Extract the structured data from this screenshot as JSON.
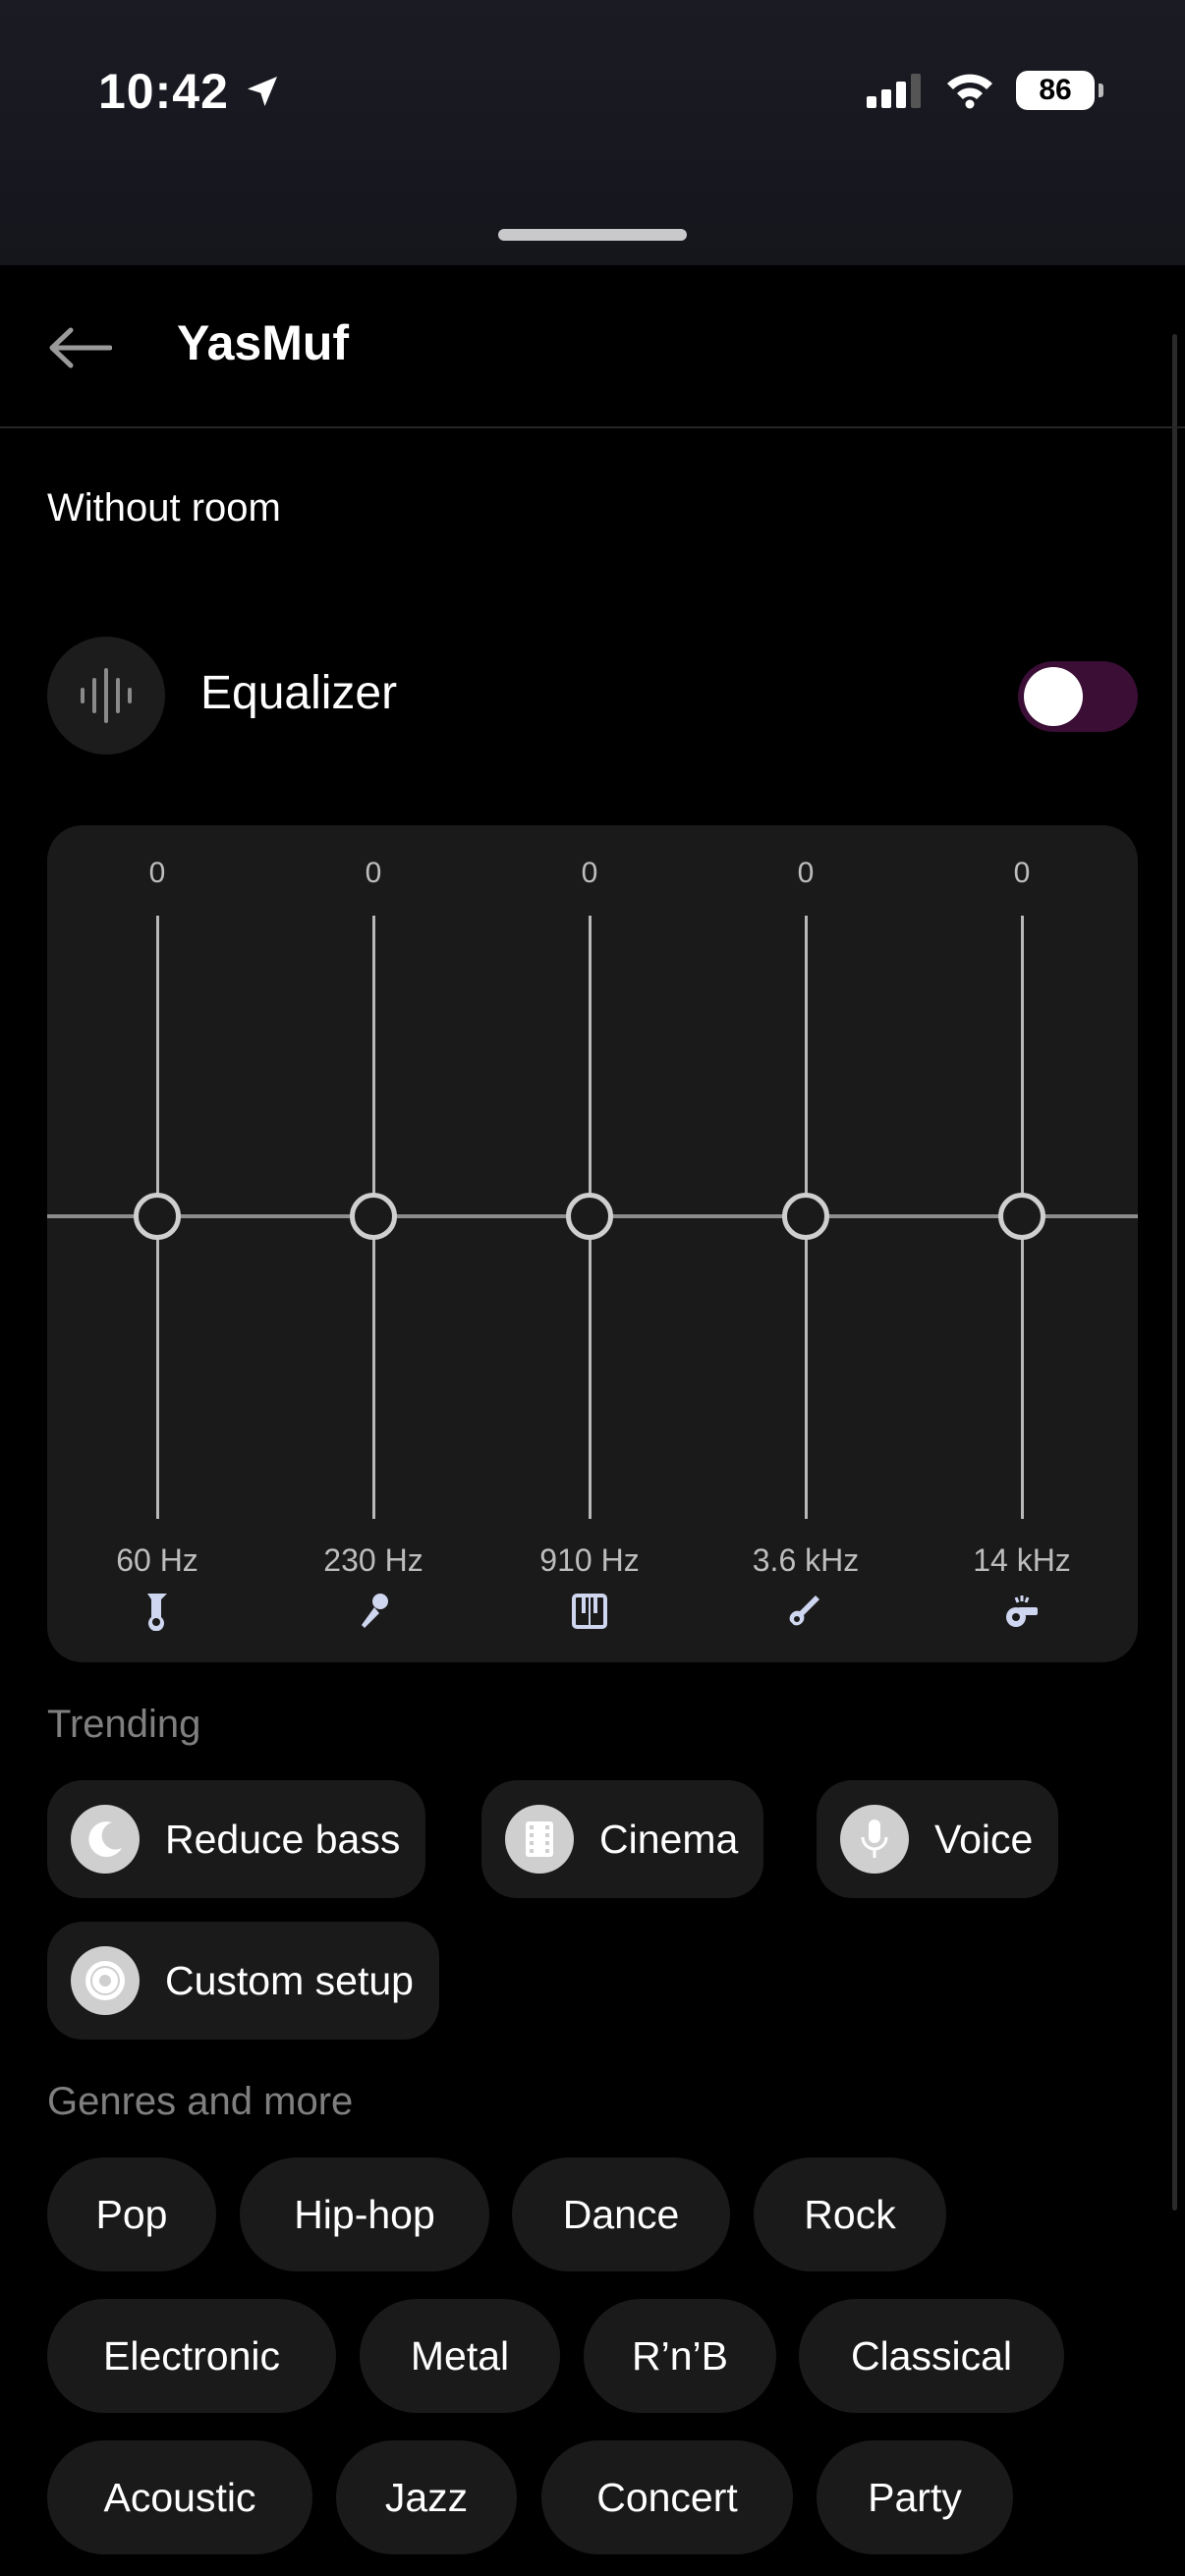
{
  "status": {
    "time": "10:42",
    "battery": "86"
  },
  "header": {
    "title": "YasMuf"
  },
  "subtitle": "Without room",
  "equalizer": {
    "label": "Equalizer",
    "enabled": false,
    "toggle_color": "#3a0e35",
    "bands": [
      {
        "value": "0",
        "freq": "60 Hz",
        "icon": "tuba-icon"
      },
      {
        "value": "0",
        "freq": "230 Hz",
        "icon": "microphone-icon"
      },
      {
        "value": "0",
        "freq": "910 Hz",
        "icon": "piano-icon"
      },
      {
        "value": "0",
        "freq": "3.6 kHz",
        "icon": "guitar-icon"
      },
      {
        "value": "0",
        "freq": "14 kHz",
        "icon": "whistle-icon"
      }
    ]
  },
  "trending": {
    "heading": "Trending",
    "items": [
      {
        "label": "Reduce bass",
        "icon": "moon-icon"
      },
      {
        "label": "Cinema",
        "icon": "film-icon"
      },
      {
        "label": "Voice",
        "icon": "microphone-icon"
      },
      {
        "label": "Custom setup",
        "icon": "vinyl-icon"
      }
    ]
  },
  "genres": {
    "heading": "Genres and more",
    "items": [
      "Pop",
      "Hip-hop",
      "Dance",
      "Rock",
      "Electronic",
      "Metal",
      "R’n’B",
      "Classical",
      "Acoustic",
      "Jazz",
      "Concert",
      "Party"
    ]
  }
}
